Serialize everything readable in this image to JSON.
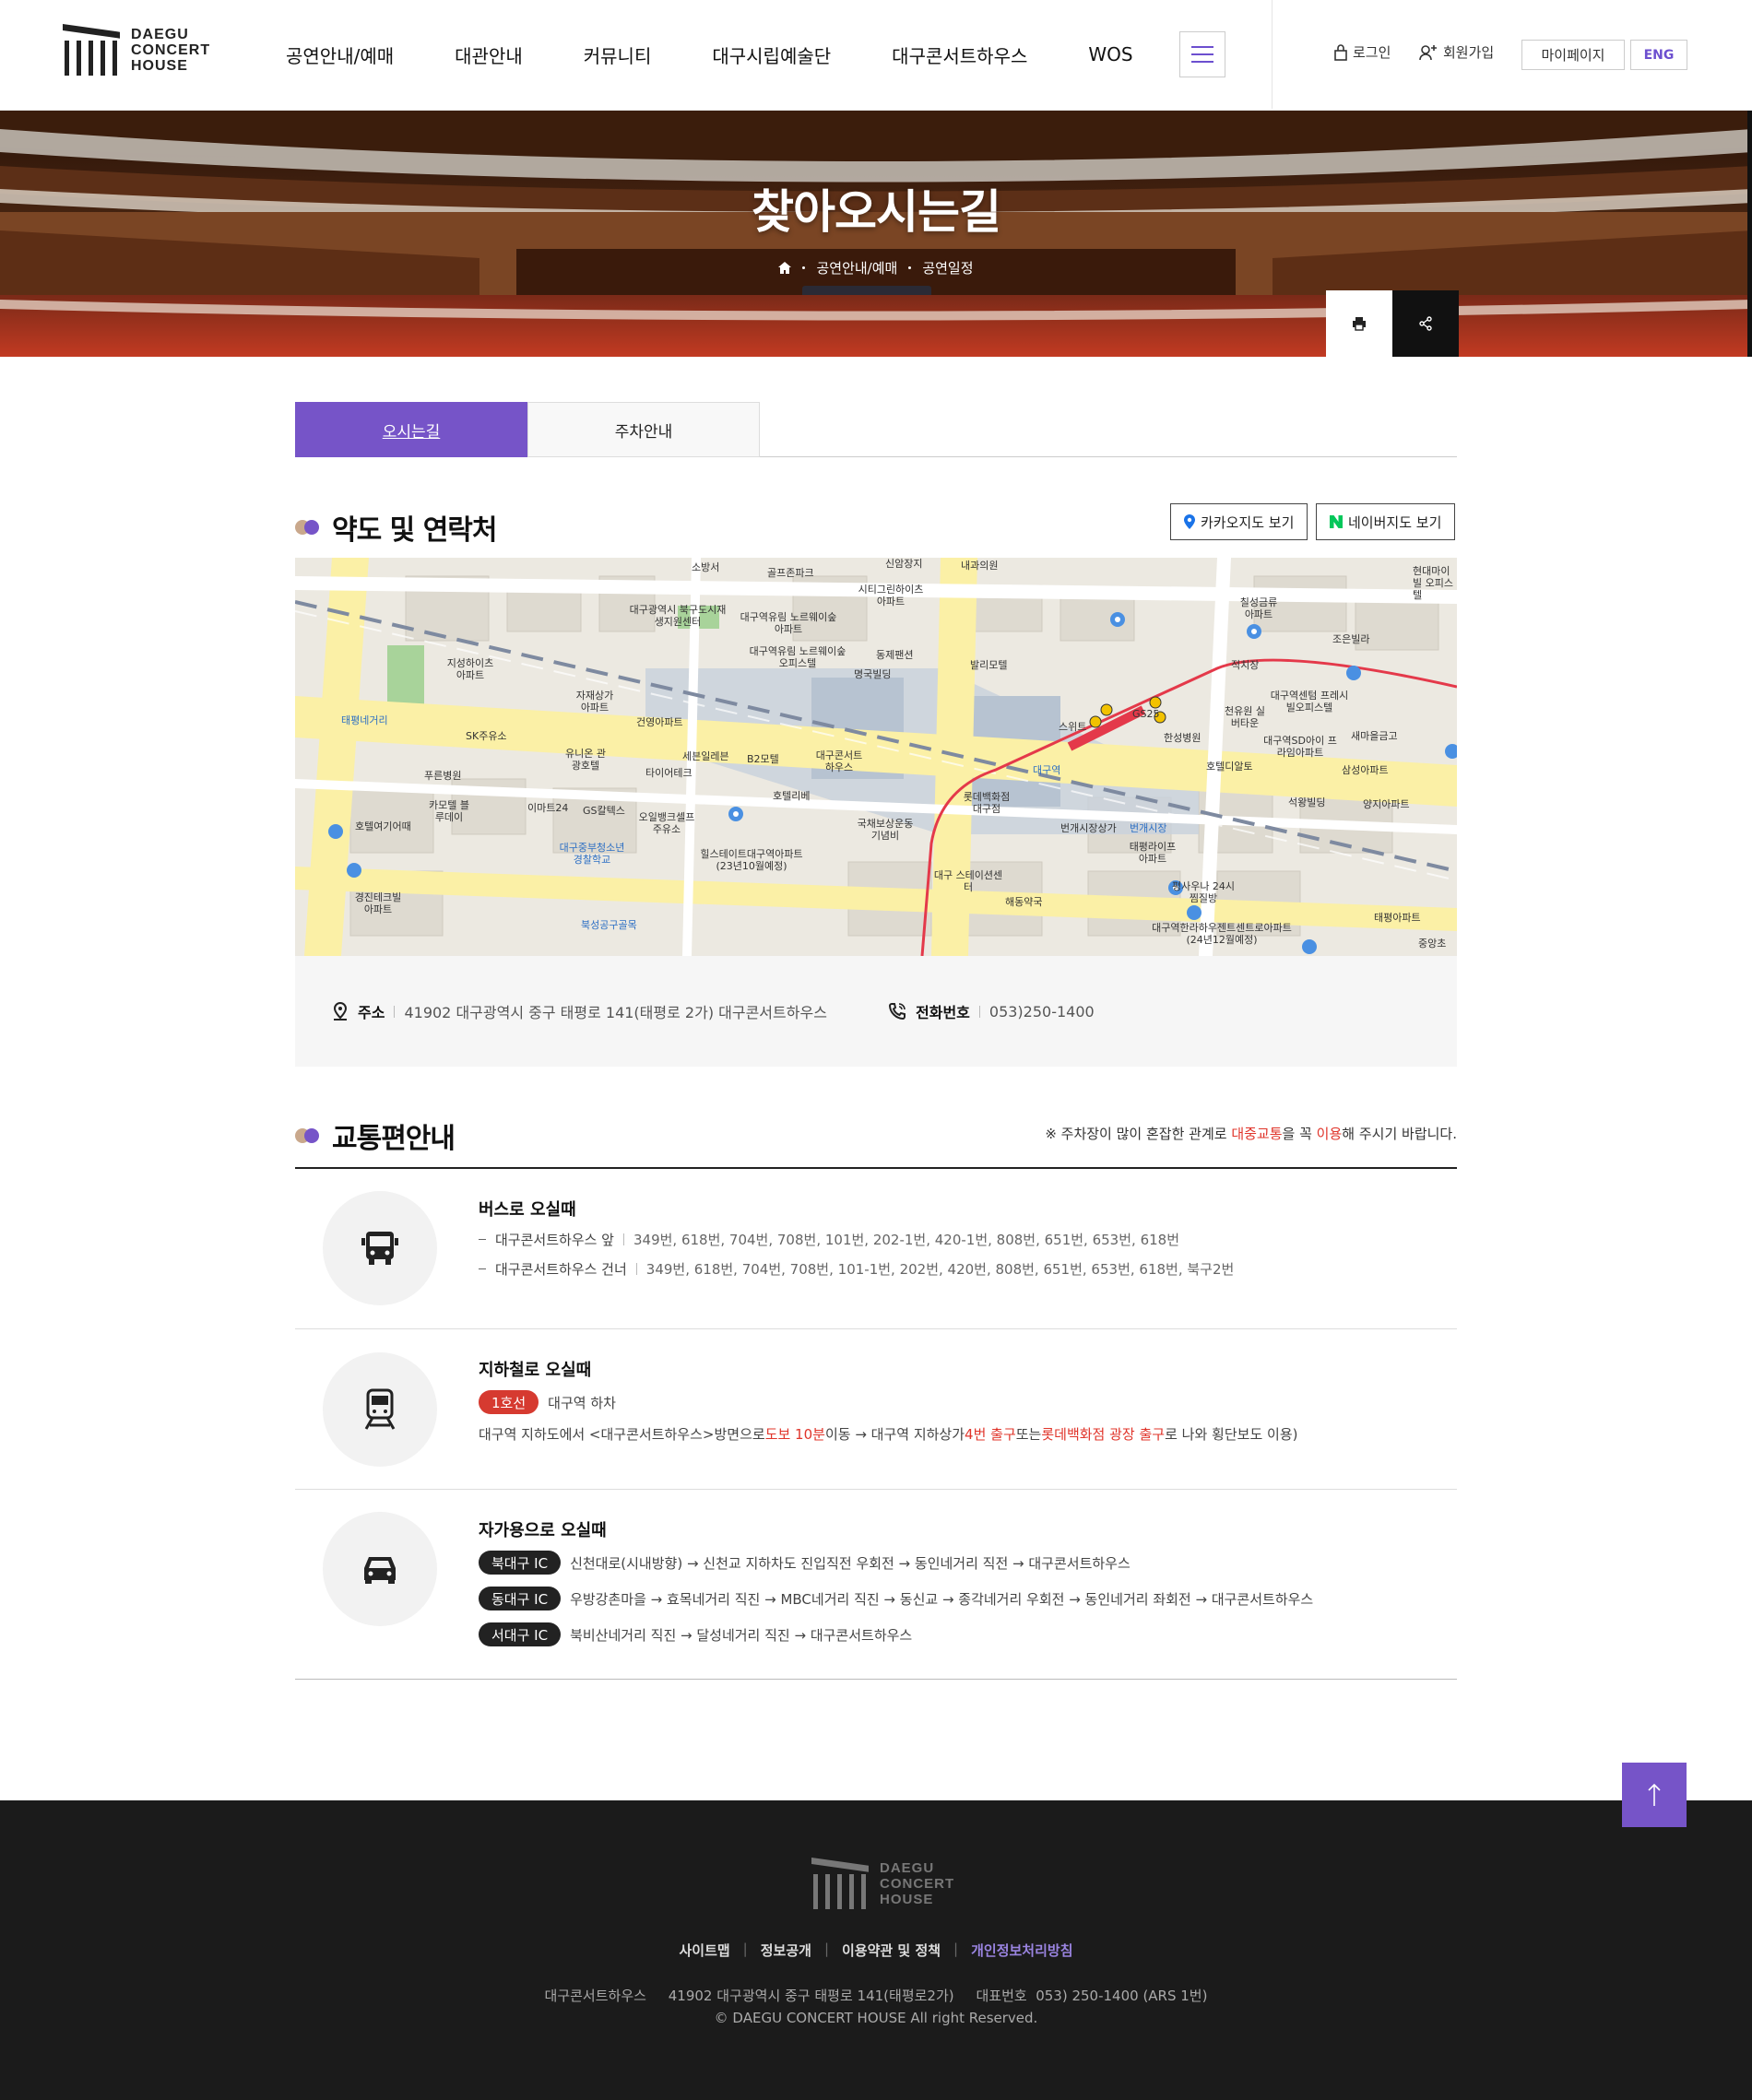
{
  "header": {
    "logo_lines": [
      "DAEGU",
      "CONCERT",
      "HOUSE"
    ],
    "nav": [
      "공연안내/예매",
      "대관안내",
      "커뮤니티",
      "대구시립예술단",
      "대구콘서트하우스",
      "WOS"
    ],
    "login": "로그인",
    "signup": "회원가입",
    "mypage": "마이페이지",
    "eng": "ENG"
  },
  "visual": {
    "title": "찾아오시는길",
    "breadcrumb": [
      "공연안내/예매",
      "공연일정"
    ]
  },
  "tabs": [
    "오시는길",
    "주차안내"
  ],
  "location": {
    "title": "약도 및 연락처",
    "kakao_button": "카카오지도 보기",
    "naver_button": "네이버지도 보기",
    "address_label": "주소",
    "address_value": "41902  대구광역시 중구 태평로 141(태평로 2가) 대구콘서트하우스",
    "phone_label": "전화번호",
    "phone_value": "053)250-1400",
    "map_labels": [
      "소방서",
      "골프존파크",
      "신암장지",
      "내과의원",
      "현대마이빌 오피스텔",
      "시티그린하이츠 아파트",
      "칠성금류 아파트",
      "조은빌라",
      "대구광역시 북구도시재생지원센터",
      "대구역유림 노르웨이숲아파트",
      "대구역유림 노르웨이숲오피스텔",
      "동제팬션",
      "명국빌딩",
      "발리모텔",
      "적치장",
      "지성하이츠 아파트",
      "자재상가 아파트",
      "건영아파트",
      "대구역센텀 프레시빌오피스텔",
      "새마을금고",
      "태평네거리",
      "SK주유소",
      "세븐일레븐",
      "B2모텔",
      "대구콘서트 하우스",
      "스위트",
      "GS25",
      "한성병원",
      "천유원 실버타운",
      "대구역SD아이 프라임아파트",
      "삼성아파트",
      "유니온 관광호텔",
      "타이어테크",
      "호텔리베",
      "대구역",
      "롯데백화점 대구점",
      "호텔디알토",
      "석왕빌딩",
      "양지아파트",
      "푸른병원",
      "카모텔 블루데이",
      "이마트24",
      "GS칼텍스",
      "오일뱅크셀프 주유소",
      "국채보상운동 기념비",
      "번개시장상가",
      "번개시장",
      "태평라이프 아파트",
      "호텔여기어때",
      "대구중부청소년 경찰학교",
      "힐스테이트대구역아파트 (23년10월예정)",
      "대구 스테이션센터",
      "해동약국",
      "평사우나 24시찜질방",
      "대구역한라하우젠트센트로아파트 (24년12월예정)",
      "태평아파트",
      "경진테크빌 아파트",
      "북성공구골목",
      "중앙초"
    ]
  },
  "transport": {
    "title": "교통편안내",
    "notice_prefix": "※ 주차장이 많이 혼잡한 관계로 ",
    "notice_red1": "대중교통",
    "notice_mid": "을 꼭 ",
    "notice_red2": "이용",
    "notice_suffix": "해 주시기 바랍니다.",
    "bus": {
      "title": "버스로 오실때",
      "rows": [
        {
          "stop": "대구콘서트하우스 앞",
          "routes": "349번, 618번, 704번, 708번, 101번, 202-1번, 420-1번, 808번, 651번, 653번, 618번"
        },
        {
          "stop": "대구콘서트하우스 건너",
          "routes": "349번, 618번, 704번, 708번, 101-1번, 202번, 420번, 808번, 651번, 653번, 618번, 북구2번"
        }
      ]
    },
    "subway": {
      "title": "지하철로 오실때",
      "line_badge": "1호선",
      "line_text": "대구역 하차",
      "desc_1": "대구역 지하도에서 <대구콘서트하우스>방면으로 ",
      "desc_red1": "도보 10분",
      "desc_2": " 이동 → 대구역 지하상가 ",
      "desc_red2": "4번 출구",
      "desc_3": " 또는 ",
      "desc_red3": "롯데백화점 광장 출구",
      "desc_4": "로 나와 횡단보도 이용)"
    },
    "car": {
      "title": "자가용으로 오실때",
      "rows": [
        {
          "ic": "북대구 IC",
          "route": "신천대로(시내방향) → 신천교 지하차도 진입직전 우회전 → 동인네거리 직전 → 대구콘서트하우스"
        },
        {
          "ic": "동대구 IC",
          "route": "우방강촌마을 → 효목네거리 직진 → MBC네거리 직진 → 동신교 → 종각네거리 우회전 → 동인네거리 좌회전 → 대구콘서트하우스"
        },
        {
          "ic": "서대구 IC",
          "route": "북비산네거리 직진 → 달성네거리 직진 → 대구콘서트하우스"
        }
      ]
    }
  },
  "footer": {
    "logo_lines": [
      "DAEGU",
      "CONCERT",
      "HOUSE"
    ],
    "links": [
      "사이트맵",
      "정보공개",
      "이용약관 및 정책",
      "개인정보처리방침"
    ],
    "info": "대구콘서트하우스     41902 대구광역시 중구 태평로 141(태평로2가)     대표번호  053) 250-1400 (ARS 1번)",
    "copyright": "©  DAEGU CONCERT HOUSE All right Reserved."
  },
  "colors": {
    "accent": "#7654c8",
    "red": "#e0342a",
    "dark": "#1b1b1b",
    "line1": "#d63a30"
  }
}
